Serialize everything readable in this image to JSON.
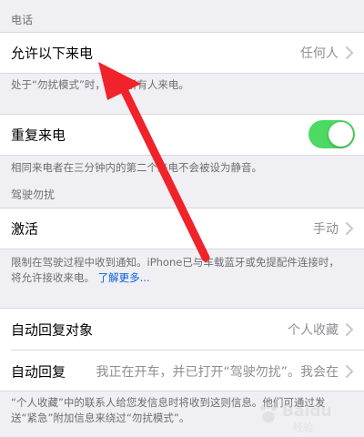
{
  "sections": {
    "calls": {
      "header": "电话",
      "allow_calls": {
        "label": "允许以下来电",
        "value": "任何人"
      },
      "allow_calls_footer": "处于“勿扰模式”时，允许所有人来电。",
      "repeated_calls": {
        "label": "重复来电",
        "enabled": true
      },
      "repeated_calls_footer": "相同来电者在三分钟内的第二个来电不会被设为静音。"
    },
    "driving": {
      "header": "驾驶勿扰",
      "activate": {
        "label": "激活",
        "value": "手动"
      },
      "activate_footer_text": "限制在驾驶过程中收到通知。iPhone已与车载蓝牙或免提配件连接时，将允许接收来电。",
      "activate_footer_link": "了解更多..."
    },
    "auto_reply": {
      "auto_reply_to": {
        "label": "自动回复对象",
        "value": "个人收藏"
      },
      "auto_reply": {
        "label": "自动回复",
        "value": "我正在开车，并已打开“驾驶勿扰”。我会在"
      },
      "footer": "“个人收藏”中的联系人给您发信息时将收到这则信息。他们可通过发送“紧急”附加信息来绕过“勿扰模式”。"
    }
  },
  "colors": {
    "background": "#efeff4",
    "toggle_on": "#4cd964",
    "link": "#0a60d8",
    "annotation_arrow": "#f0232a"
  },
  "watermark": {
    "brand": "Baidu",
    "sub": "经验"
  }
}
